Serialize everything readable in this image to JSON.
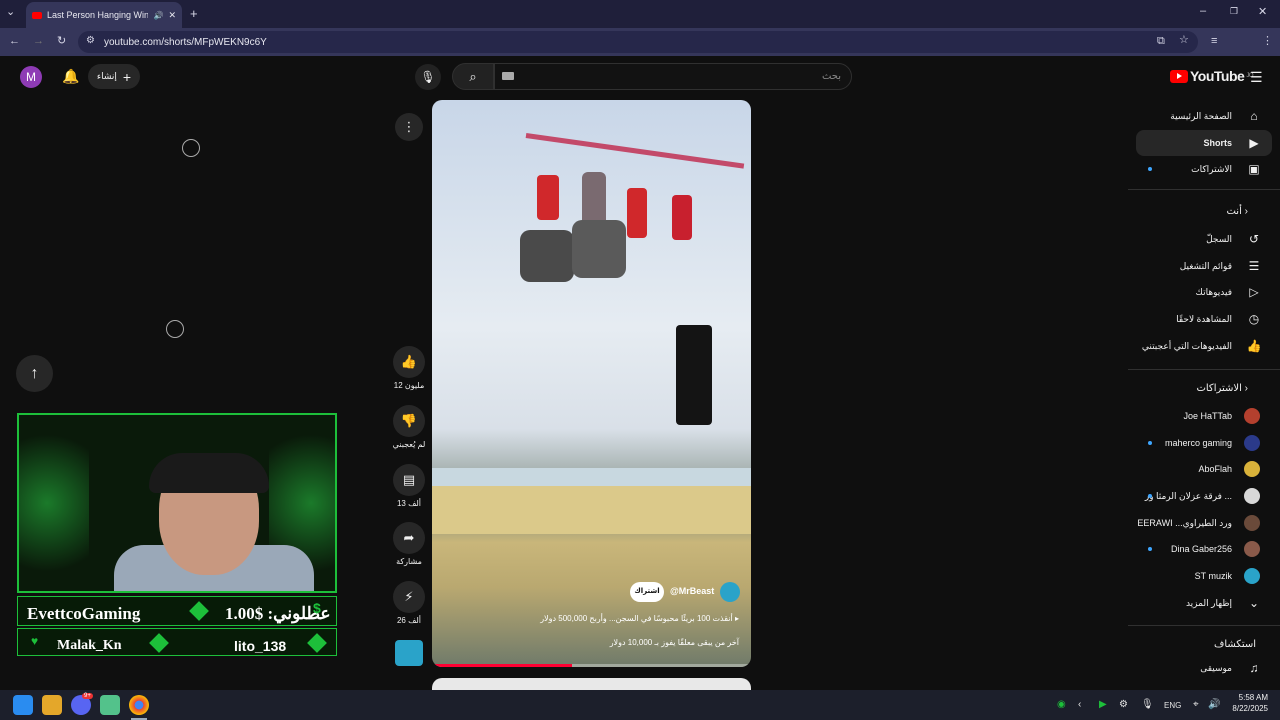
{
  "browser": {
    "tab_title": "Last Person Hanging Wins $",
    "url": "youtube.com/shorts/MFpWEKN9c6Y",
    "profile_letter": "M"
  },
  "masthead": {
    "avatar_letter": "M",
    "create_label": "إنشاء",
    "search_placeholder": "بحث",
    "logo_text": "YouTube",
    "logo_region": "JO"
  },
  "sidebar": {
    "main": [
      {
        "label": "الصفحة الرئيسية",
        "icon": "home-icon",
        "glyph": "⌂"
      },
      {
        "label": "Shorts",
        "icon": "shorts-icon",
        "glyph": "▶"
      },
      {
        "label": "الاشتراكات",
        "icon": "subscriptions-icon",
        "glyph": "▣"
      }
    ],
    "you_header": "أنت",
    "you": [
      {
        "label": "السجلّ",
        "icon": "history-icon",
        "glyph": "↺"
      },
      {
        "label": "قوائم التشغيل",
        "icon": "playlists-icon",
        "glyph": "☰"
      },
      {
        "label": "فيديوهاتك",
        "icon": "your-videos-icon",
        "glyph": "▷"
      },
      {
        "label": "المشاهدة لاحقًا",
        "icon": "watch-later-icon",
        "glyph": "◷"
      },
      {
        "label": "الفيديوهات التي أعجبتني",
        "icon": "liked-icon",
        "glyph": "👍"
      }
    ],
    "subs_header": "الاشتراكات",
    "subs": [
      {
        "label": "Joe HaTTab",
        "color": "#b4402e",
        "dot": false
      },
      {
        "label": "maherco gaming",
        "color": "#2b3a8a",
        "dot": true
      },
      {
        "label": "AboFlah",
        "color": "#d9b23a",
        "dot": false
      },
      {
        "label": "فرقة عزلان الرمثا ور ...",
        "color": "#d8d8d8",
        "dot": true
      },
      {
        "label": "EERAWI ...ورد الطيراوي",
        "color": "#6a4a3a",
        "dot": false
      },
      {
        "label": "Dina Gaber256",
        "color": "#8a5a4a",
        "dot": true
      },
      {
        "label": "ST muzik",
        "color": "#2aa3c9",
        "dot": false
      }
    ],
    "show_more": "إظهار المزيد",
    "explore_header": "استكشاف",
    "explore": [
      {
        "label": "موسيقى",
        "icon": "music-icon",
        "glyph": "♫"
      }
    ]
  },
  "short": {
    "channel": "@MrBeast",
    "subscribe": "اشتراك",
    "title_line1": "أنقذت 100 بريئًا محبوسًا في السجن... وأربح 500,000 دولار",
    "title_line2": "آخر من يبقى معلقًا يفوز بـ 10,000 دولار",
    "progress": 0.44
  },
  "actions": {
    "likes": "12 مليون",
    "dislike": "لم يُعجبني",
    "comments": "13 ألف",
    "share": "مشاركة",
    "remix": "26 ألف"
  },
  "overlay": {
    "streamer": "EvettcoGaming",
    "donation": "1.00$ :عطلوني",
    "donor_left": "Malak_Kn",
    "donor_right": "lito_138"
  },
  "taskbar": {
    "lang": "ENG",
    "time": "5:58 AM",
    "date": "8/22/2025",
    "discord_badge": "9+"
  },
  "colors": {
    "accent_green": "#1dbf3a",
    "yt_red": "#ff0000"
  }
}
